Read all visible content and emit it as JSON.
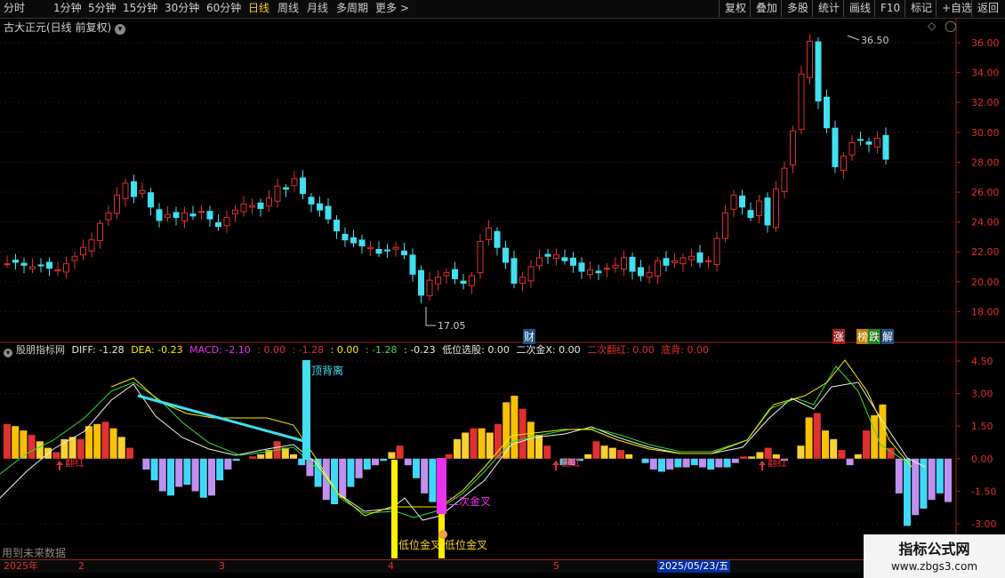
{
  "toolbar": {
    "left": [
      "分时",
      "1分钟",
      "5分钟",
      "15分钟",
      "30分钟",
      "60分钟",
      "日线",
      "周线",
      "月线",
      "多周期",
      "更多 >"
    ],
    "active": "日线",
    "right": [
      "复权",
      "叠加",
      "多股",
      "统计",
      "画线",
      "F10",
      "标记",
      "+自选",
      "返回"
    ]
  },
  "stock": {
    "title": "古大正元(日线 前复权)"
  },
  "price_axis": [
    "36.00",
    "34.00",
    "32.00",
    "30.00",
    "28.00",
    "26.00",
    "24.00",
    "22.00",
    "20.00",
    "18.00"
  ],
  "price_markers": {
    "high": "36.50",
    "low": "17.05"
  },
  "badges": {
    "cai": "财",
    "zhang": "涨",
    "bang": "榜",
    "die": "跌",
    "jie": "解"
  },
  "indicator": {
    "name": "股朋指标网",
    "diff": "DIFF: -1.28",
    "dea": "DEA: -0.23",
    "macd": "MACD: -2.10",
    "v1": ": 0.00",
    "v2": ": -1.28",
    "v3": ": 0.00",
    "v4": ": -1.28",
    "v5": ": -0.23",
    "dixuan": "低位选股: 0.00",
    "erci": "二次金X: 0.00",
    "ercifan": "二次翻红: 0.00",
    "dibei": "底背: 0.00"
  },
  "macd_axis": [
    "4.50",
    "3.00",
    "1.50",
    "0.00",
    "-1.50",
    "-3.00"
  ],
  "labels": {
    "dingbeili": "顶背离",
    "dijin1": "低位金叉",
    "dijin2": "低位金叉",
    "erjin": "二次金叉",
    "fanhong": "翻红"
  },
  "dates": [
    "2025年",
    "2",
    "3",
    "4",
    "5"
  ],
  "cursor_date": "2025/05/23/五",
  "hint": "用到未来数据",
  "watermark": {
    "line1": "指标公式网",
    "line2": "www.zbgs3.com"
  },
  "colors": {
    "up": "#e03030",
    "down": "#40e0f0",
    "yellow": "#f8d030",
    "magenta": "#f030f0"
  }
}
